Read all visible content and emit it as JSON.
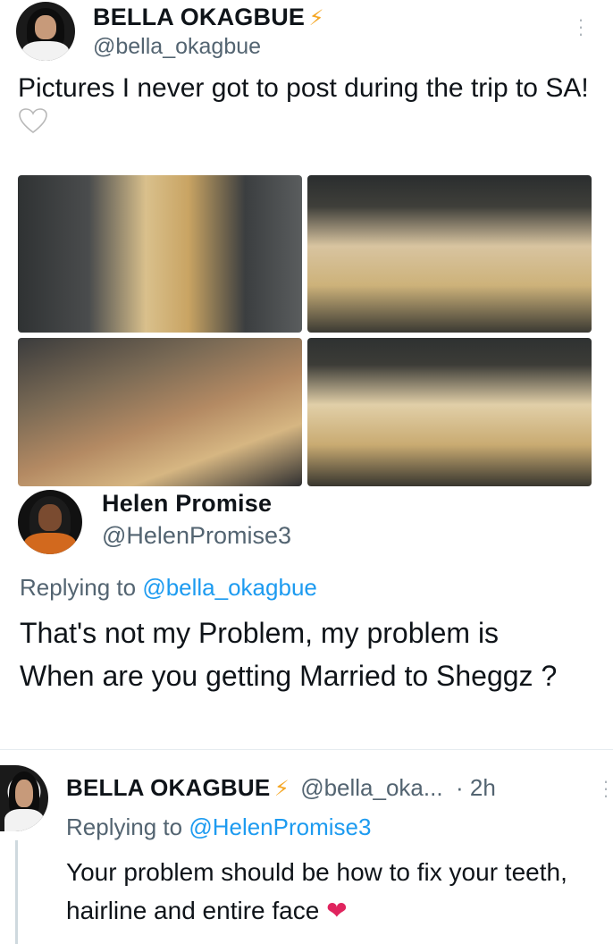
{
  "tweet": {
    "author_name": "BELLA OKAGBUE",
    "author_handle": "@bella_okagbue",
    "text": "Pictures I never got to post during the trip to SA!",
    "photos": [
      "photo-1",
      "photo-2",
      "photo-3",
      "photo-4"
    ]
  },
  "reply1": {
    "author_name": "Helen Promise",
    "author_handle": "@HelenPromise3",
    "replying_prefix": "Replying to ",
    "replying_handle": "@bella_okagbue",
    "text": "That's not my Problem, my problem is  When are you getting Married to Sheggz ?"
  },
  "reply2": {
    "author_name": "BELLA OKAGBUE",
    "author_handle": "@bella_oka...",
    "time": "· 2h",
    "replying_prefix": "Replying to ",
    "replying_handle": "@HelenPromise3",
    "text": "Your problem should be how to fix your teeth, hairline and entire face"
  },
  "icons": {
    "verified": "lightning-bolt-icon",
    "more": "more-vertical-icon",
    "white_heart": "white-heart-icon",
    "red_heart": "red-heart-icon"
  },
  "colors": {
    "link": "#1d9bf0",
    "secondary": "#536471",
    "bolt": "#f5a623",
    "heart": "#e0245e"
  }
}
